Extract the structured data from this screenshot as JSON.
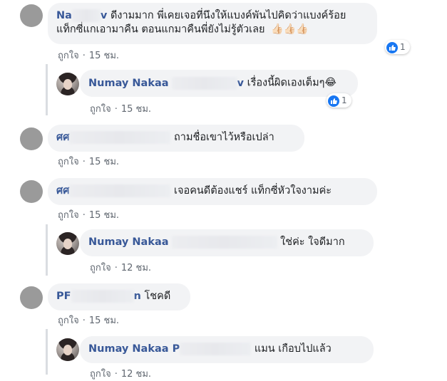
{
  "comments": [
    {
      "author_visible": "Na",
      "author_tail": "v",
      "text_line1": "ดีงามมาก พี่เคยเจอที่นึงให้แบงค์พันไปคิดว่าแบงค์ร้อย",
      "text_line2": "แท็กซี่แกเอามาคืน ตอนแกมาคืนพี่ยังไม่รู้ตัวเลย",
      "emoji": "👍🏻👍🏻👍🏻",
      "like_label": "ถูกใจ",
      "time": "15 ชม.",
      "reaction_count": "1"
    },
    {
      "author_visible": "Numay Nakaa",
      "author_tail": "v",
      "text": "เรื่องนี้ผิดเองเต็มๆ",
      "emoji": "😂",
      "like_label": "ถูกใจ",
      "time": "15 ชม.",
      "reaction_count": "1"
    },
    {
      "author_visible": "ศศ",
      "text": "ถามชื่อเขาไว้หรือเปล่า",
      "like_label": "ถูกใจ",
      "time": "15 ชม."
    },
    {
      "author_visible": "ศศ",
      "text": "เจอคนดีต้องแชร์ แท็กซี่หัวใจงามค่ะ",
      "like_label": "ถูกใจ",
      "time": "15 ชม."
    },
    {
      "author_visible": "Numay Nakaa",
      "text": "ใช่ค่ะ ใจดีมาก",
      "like_label": "ถูกใจ",
      "time": "12 ชม."
    },
    {
      "author_visible": "PF",
      "author_tail": "n",
      "text": "โชคดี",
      "like_label": "ถูกใจ",
      "time": "15 ชม."
    },
    {
      "author_visible": "Numay Nakaa",
      "author_tail": "P",
      "text": "แมน เกือบไปแล้ว",
      "like_label": "ถูกใจ",
      "time": "12 ชม."
    }
  ],
  "separator": "·",
  "colors": {
    "author": "#385898",
    "bubble": "#f2f3f5",
    "meta": "#606770",
    "like_blue": "#1877f2"
  },
  "icons": {
    "reaction": "thumbs-up-icon"
  }
}
